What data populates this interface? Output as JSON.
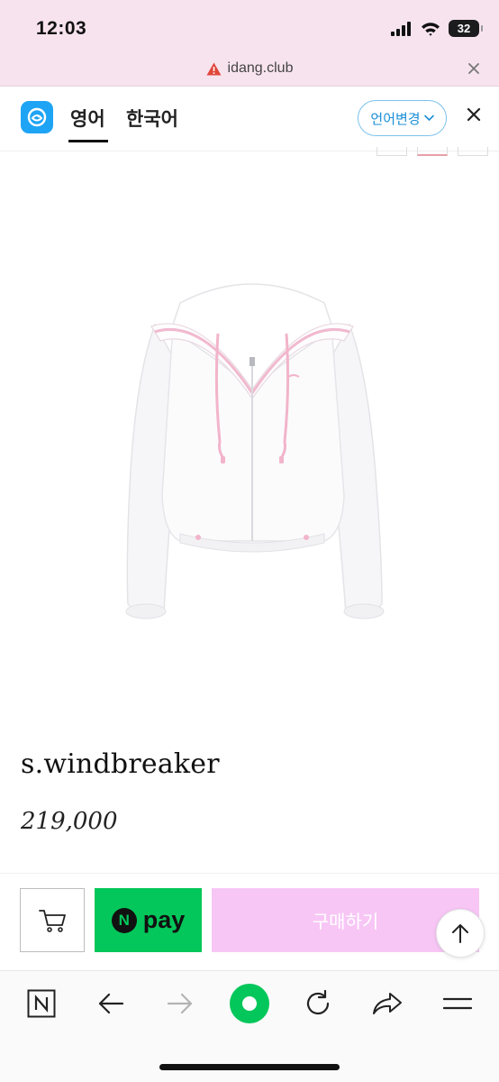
{
  "status_bar": {
    "time": "12:03",
    "battery": "32"
  },
  "url_bar": {
    "domain": "idang.club",
    "warning_icon": "warning-triangle-icon",
    "close_icon": "close-icon"
  },
  "translate_bar": {
    "source_lang": "영어",
    "target_lang": "한국어",
    "change_label": "언어변경",
    "logo_icon": "papago-logo",
    "close_icon": "close-icon"
  },
  "product": {
    "name": "s.windbreaker",
    "price": "219,000",
    "image": "white-windbreaker-jacket-image"
  },
  "purchase": {
    "cart_icon": "cart-icon",
    "npay_mark": "N",
    "npay_label": "pay",
    "buy_label": "구매하기",
    "npay_color": "#03c75a",
    "buy_color": "#f7c6f5"
  },
  "toolbar": {
    "icons": [
      "naver-n-icon",
      "back-arrow-icon",
      "forward-arrow-icon",
      "green-home-dot-icon",
      "refresh-icon",
      "share-icon",
      "menu-icon"
    ]
  },
  "accent_color": "#1ea4f5"
}
